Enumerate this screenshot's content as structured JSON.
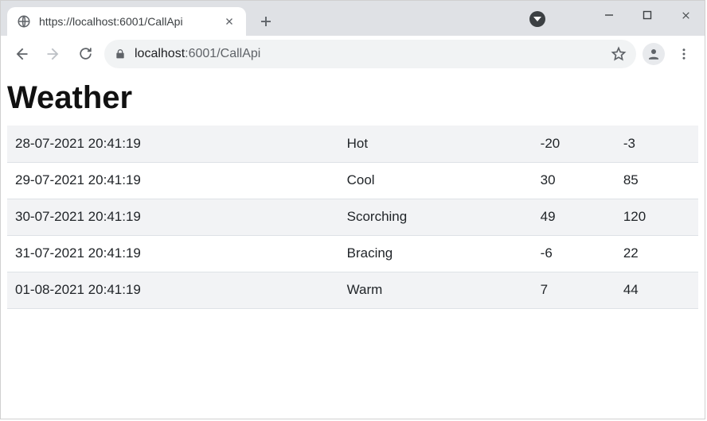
{
  "tab": {
    "title": "https://localhost:6001/CallApi"
  },
  "address": {
    "host": "localhost",
    "rest": ":6001/CallApi"
  },
  "page": {
    "heading": "Weather",
    "rows": [
      {
        "date": "28-07-2021 20:41:19",
        "desc": "Hot",
        "a": "-20",
        "b": "-3"
      },
      {
        "date": "29-07-2021 20:41:19",
        "desc": "Cool",
        "a": "30",
        "b": "85"
      },
      {
        "date": "30-07-2021 20:41:19",
        "desc": "Scorching",
        "a": "49",
        "b": "120"
      },
      {
        "date": "31-07-2021 20:41:19",
        "desc": "Bracing",
        "a": "-6",
        "b": "22"
      },
      {
        "date": "01-08-2021 20:41:19",
        "desc": "Warm",
        "a": "7",
        "b": "44"
      }
    ]
  }
}
